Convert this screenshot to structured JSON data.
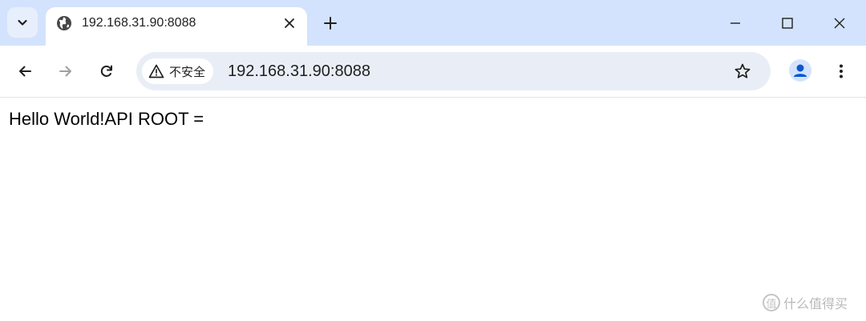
{
  "tab": {
    "title": "192.168.31.90:8088",
    "favicon": "globe-icon"
  },
  "toolbar": {
    "security_label": "不安全",
    "url": "192.168.31.90:8088"
  },
  "page": {
    "text": "Hello World!API ROOT ="
  },
  "watermark": {
    "logo": "值",
    "text": "什么值得买"
  },
  "colors": {
    "tabstrip": "#d3e3fd",
    "omnibox": "#e9eef6",
    "avatar_fg": "#0b57d0"
  }
}
